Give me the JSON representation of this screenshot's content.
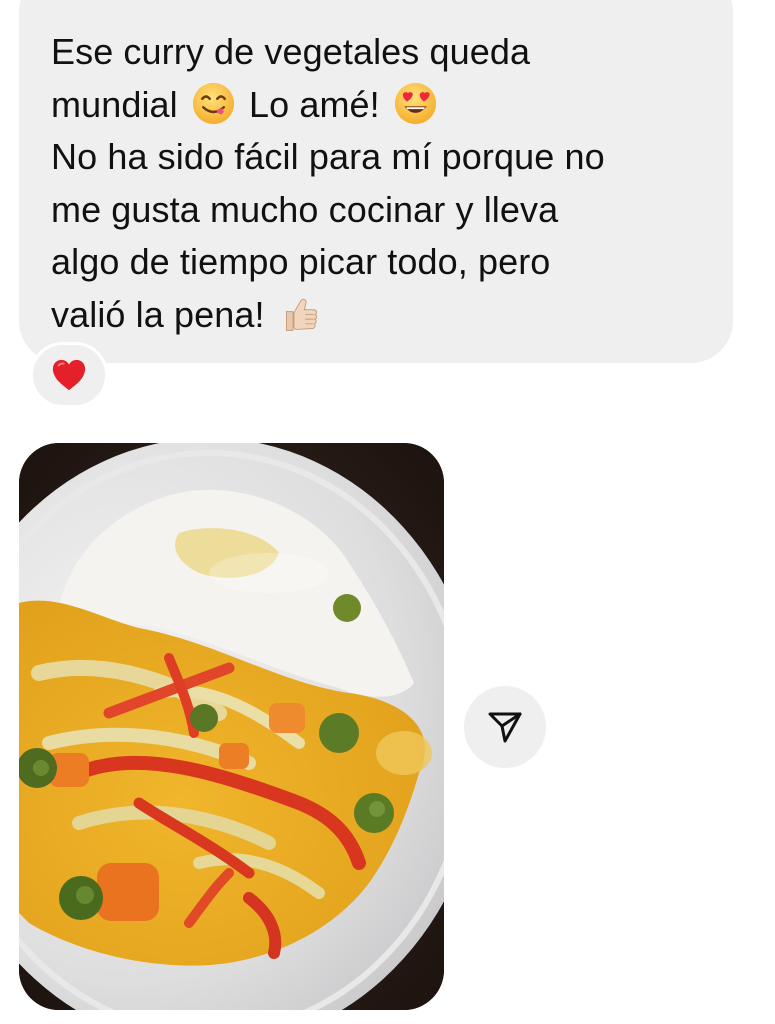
{
  "message": {
    "line_1": "Ese curry de vegetales queda",
    "line_2_a": "mundial",
    "line_2_b": "Lo amé!",
    "line_3": "No ha sido fácil para mí porque no",
    "line_4": "me gusta mucho cocinar y lleva",
    "line_5": "algo de tiempo picar todo, pero",
    "line_6": "valió la pena!",
    "emojis": [
      "yum-face-emoji",
      "heart-eyes-emoji",
      "thumbs-up-emoji"
    ],
    "bubble_color": "#efefef"
  },
  "reaction": {
    "emoji": "red-heart",
    "color": "#e4202a"
  },
  "attachment": {
    "type": "photo",
    "subject": "vegetable-curry-with-rice"
  },
  "share_button": {
    "icon": "paper-plane-icon"
  }
}
